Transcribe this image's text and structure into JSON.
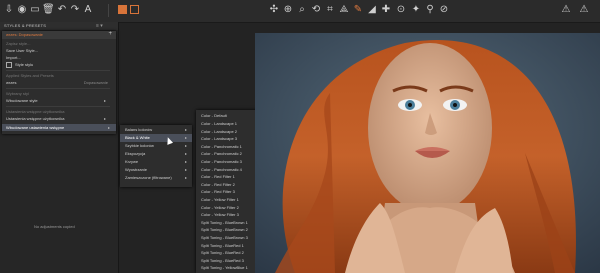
{
  "toolbar": {
    "left_icons": [
      "import-icon",
      "camera-icon",
      "folder-icon",
      "trash-icon",
      "undo-icon",
      "redo-icon",
      "text-icon",
      "pin-icon",
      "crop-icon",
      "brush-icon",
      "gear-icon",
      "grid-icon",
      "view-icon"
    ],
    "accent": "#d8743a"
  },
  "left_panel": {
    "title": "STYLES & PRESETS",
    "no_adjustments": "No adjustments copied"
  },
  "menu": {
    "search_text": "wrzes: Dopasowanie",
    "items": [
      {
        "label": "Zapisz style...",
        "disabled": false,
        "arrow": false
      },
      {
        "label": "Save User Style...",
        "disabled": false,
        "arrow": false
      },
      {
        "label": "Import...",
        "disabled": false,
        "arrow": false
      },
      {
        "label": "Style stylu",
        "disabled": false,
        "arrow": false,
        "check": true
      },
      {
        "label": "Applied Styles and Presets",
        "disabled": true,
        "arrow": false
      },
      {
        "label": "wrzes",
        "disabled": false,
        "arrow": false,
        "right": "Dopasowanie"
      },
      {
        "label": "Wybrany styl",
        "disabled": true,
        "arrow": false
      },
      {
        "label": "Wbudowane style",
        "disabled": false,
        "arrow": true
      },
      {
        "label": "Ustawienia wstępne użytkownika",
        "disabled": true,
        "arrow": true
      },
      {
        "label": "Ustawienia wstępne użytkownika",
        "disabled": false,
        "arrow": true
      },
      {
        "label": "Wbudowane ustawienia wstępne",
        "disabled": false,
        "arrow": true,
        "highlight": true
      }
    ]
  },
  "submenu1": {
    "items": [
      {
        "label": "Balans kolorów",
        "arrow": true
      },
      {
        "label": "Black & White",
        "arrow": true,
        "highlight": true
      },
      {
        "label": "Szybkie kolorów",
        "arrow": true
      },
      {
        "label": "Ekspozycja",
        "arrow": true
      },
      {
        "label": "Krzywe",
        "arrow": true
      },
      {
        "label": "Wyostrzanie",
        "arrow": true
      },
      {
        "label": "Zamieszczone (filtrowane)",
        "arrow": true
      }
    ]
  },
  "submenu2": {
    "items": [
      "Color - Default",
      "Color - Landscape 1",
      "Color - Landscape 2",
      "Color - Landscape 3",
      "Color - Panchromatic 1",
      "Color - Panchromatic 2",
      "Color - Panchromatic 3",
      "Color - Panchromatic 4",
      "Color - Red Filter 1",
      "Color - Red Filter 2",
      "Color - Red Filter 3",
      "Color - Yellow Filter 1",
      "Color - Yellow Filter 2",
      "Color - Yellow Filter 3",
      "Split Toning - BlueBrown 1",
      "Split Toning - BlueBrown 2",
      "Split Toning - BlueBrown 3",
      "Split Toning - BlueRed 1",
      "Split Toning - BlueRed 2",
      "Split Toning - BlueRed 3",
      "Split Toning - YellowBlue 1"
    ]
  }
}
